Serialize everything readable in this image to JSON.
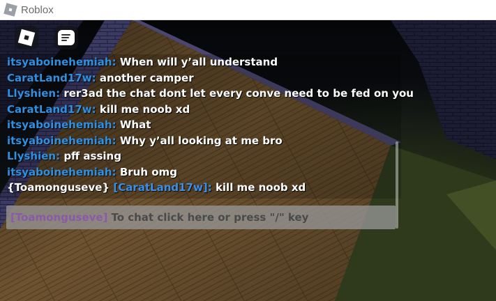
{
  "window": {
    "title": "Roblox"
  },
  "colors": {
    "speaker_blue": "#2f8fe0",
    "system_tag_blue": "#3a8fe8",
    "message_white": "#ffffff",
    "input_name_purple": "#8a5aa8"
  },
  "topbar": {
    "menu_icon": "roblox-logo-icon",
    "chat_icon": "chat-icon"
  },
  "chat": {
    "messages": [
      {
        "speaker": "itsyaboinehemiah:",
        "text": "When will y’all understand"
      },
      {
        "speaker": "CaratLand17w:",
        "text": "another camper"
      },
      {
        "speaker": "Llyshien:",
        "text": "rer3ad the chat dont let every conve need to be fed on you"
      },
      {
        "speaker": "CaratLand17w:",
        "text": "kill me noob xd"
      },
      {
        "speaker": "itsyaboinehemiah:",
        "text": "What"
      },
      {
        "speaker": "itsyaboinehemiah:",
        "text": "Why y’all looking at me bro"
      },
      {
        "speaker": "Llyshien:",
        "text": "pff assing"
      },
      {
        "speaker": "itsyaboinehemiah:",
        "text": "Bruh omg"
      }
    ],
    "whisper": {
      "from": "{Toamonguseve}",
      "to": "[CaratLand17w]:",
      "text": "kill me noob xd"
    },
    "input": {
      "username_tag": "[Toamonguseve]",
      "placeholder": "To chat click here or press \"/\" key"
    }
  }
}
